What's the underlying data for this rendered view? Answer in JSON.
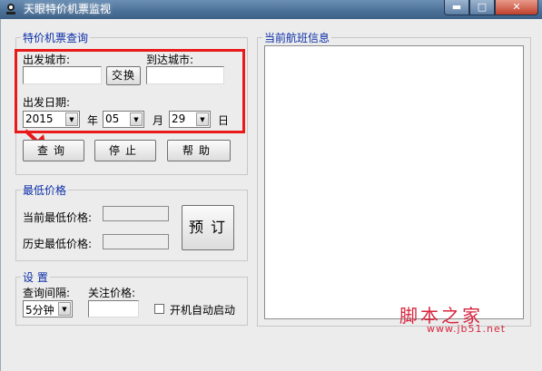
{
  "window": {
    "title": "天眼特价机票监视",
    "min_glyph": "▬",
    "max_glyph": "□",
    "close_glyph": "✕"
  },
  "query_group": {
    "legend": "特价机票查询",
    "depart_label": "出发城市:",
    "arrive_label": "到达城市:",
    "depart_value": "",
    "arrive_value": "",
    "swap_label": "交换",
    "date_label": "出发日期:",
    "year": "2015",
    "year_unit": "年",
    "month": "05",
    "month_unit": "月",
    "day": "29",
    "day_unit": "日",
    "query_label": "查询",
    "stop_label": "停止",
    "help_label": "帮助"
  },
  "price_group": {
    "legend": "最低价格",
    "current_label": "当前最低价格:",
    "history_label": "历史最低价格:",
    "current_value": "",
    "history_value": "",
    "book_label": "预订"
  },
  "settings_group": {
    "legend": "设 置",
    "interval_label": "查询间隔:",
    "interval_value": "5分钟",
    "watch_label": "关注价格:",
    "watch_value": "",
    "autostart_label": "开机自动启动",
    "autostart_checked": false
  },
  "flight_group": {
    "legend": "当前航班信息"
  },
  "watermark": {
    "logo": "脚本之家",
    "url": "www.jb51.net"
  },
  "colors": {
    "legend": "#0a2ea8",
    "highlight": "#e81a1a",
    "watermark": "#d8263e"
  }
}
